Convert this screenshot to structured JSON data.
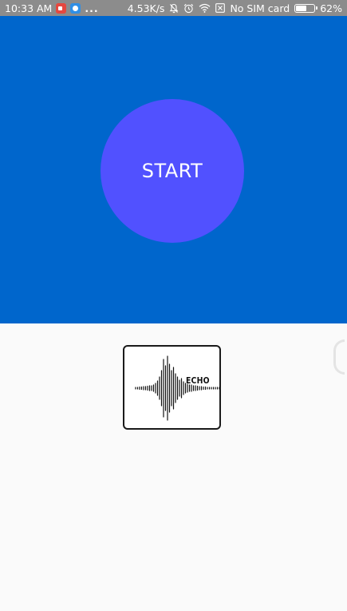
{
  "status_bar": {
    "time": "10:33 AM",
    "notification_icons": [
      "video-app-icon",
      "messenger-app-icon"
    ],
    "more": "...",
    "network_speed": "4.53K/s",
    "system_icons": [
      "mute-bell-icon",
      "alarm-icon",
      "wifi-icon",
      "no-sim-icon"
    ],
    "sim_status": "No SIM card",
    "battery_percent": "62%",
    "battery_level": 0.62,
    "background": "#8c8c8c"
  },
  "hero": {
    "background": "#0066cc",
    "start_button": {
      "label": "START",
      "color": "#5151ff"
    }
  },
  "logo": {
    "text": "ECHO",
    "icon": "sound-waveform-icon"
  },
  "colors": {
    "page_background": "#fafafa",
    "text_on_blue": "#ffffff"
  }
}
